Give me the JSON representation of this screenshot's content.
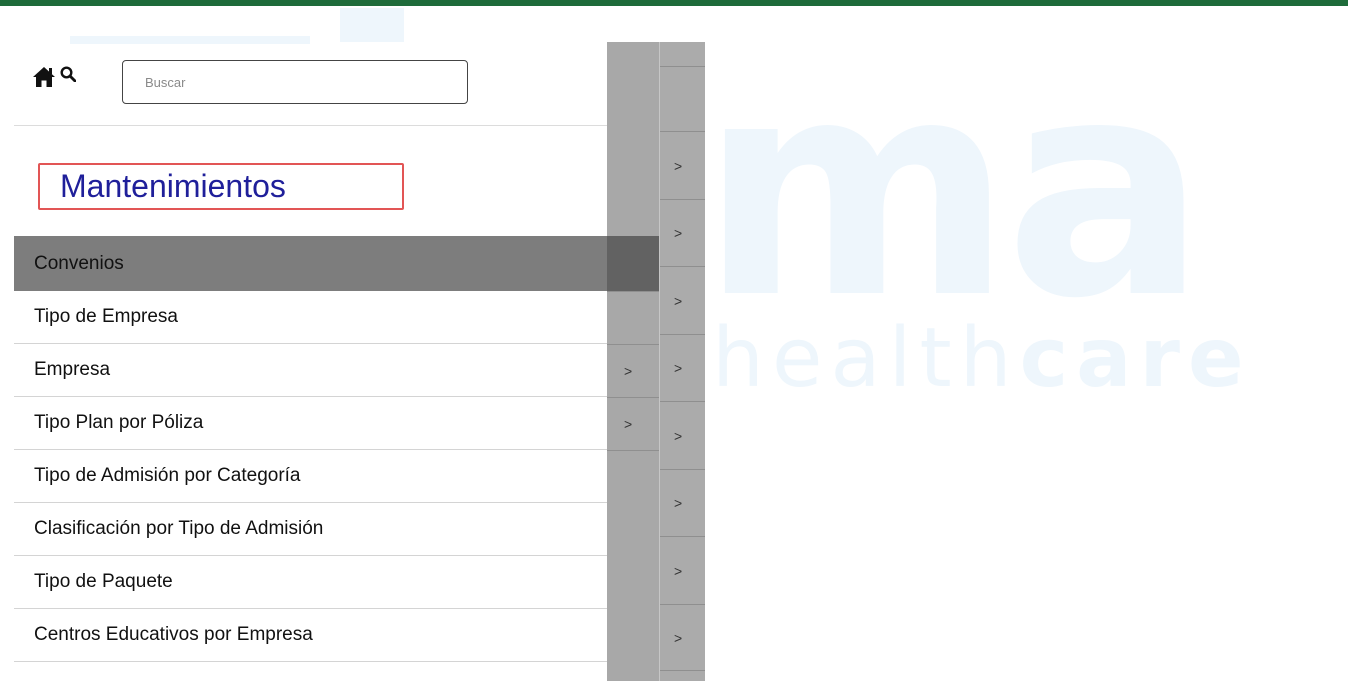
{
  "search": {
    "placeholder": "Buscar"
  },
  "section_title": "Mantenimientos",
  "menu": [
    "Convenios",
    "Tipo de Empresa",
    "Empresa",
    "Tipo Plan por Póliza",
    "Tipo de Admisión por Categoría",
    "Clasificación por Tipo de Admisión",
    "Tipo de Paquete",
    "Centros Educativos por Empresa"
  ],
  "arrow_glyph": ">",
  "watermark": {
    "main": "ma",
    "sub_light": "health",
    "sub_bold": "care"
  },
  "colors": {
    "title": "#1f1f9a",
    "highlight_border": "#e25555",
    "active_row": "#7d7d7d",
    "top_bar": "#1e6b3a"
  }
}
